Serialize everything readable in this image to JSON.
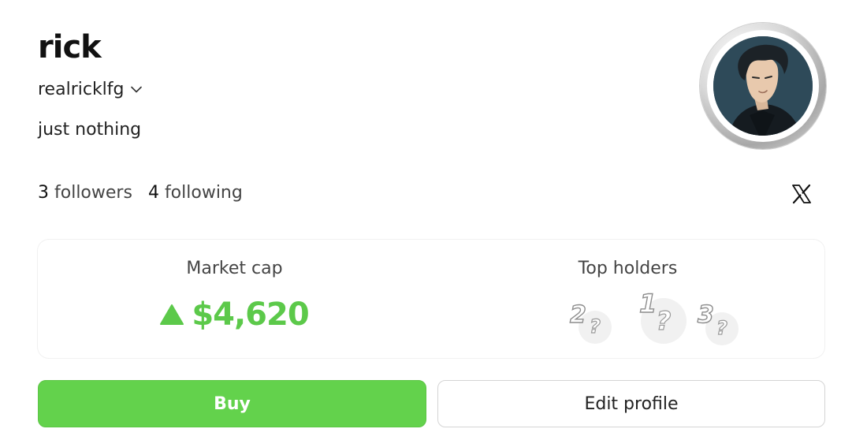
{
  "profile": {
    "display_name": "rick",
    "handle": "realricklfg",
    "bio": "just nothing",
    "followers_count": "3",
    "followers_label": "followers",
    "following_count": "4",
    "following_label": "following"
  },
  "icons": {
    "handle_dropdown": "chevron-down-icon",
    "social": "x-logo-icon",
    "market_trend": "triangle-up-icon"
  },
  "market": {
    "label": "Market cap",
    "value": "$4,620",
    "trend": "up"
  },
  "top_holders": {
    "label": "Top holders",
    "holders": [
      {
        "rank": "1",
        "placeholder": "?"
      },
      {
        "rank": "2",
        "placeholder": "?"
      },
      {
        "rank": "3",
        "placeholder": "?"
      }
    ]
  },
  "actions": {
    "buy_label": "Buy",
    "edit_label": "Edit profile"
  },
  "colors": {
    "accent_green": "#63d24c",
    "price_green": "#5cc94a"
  }
}
